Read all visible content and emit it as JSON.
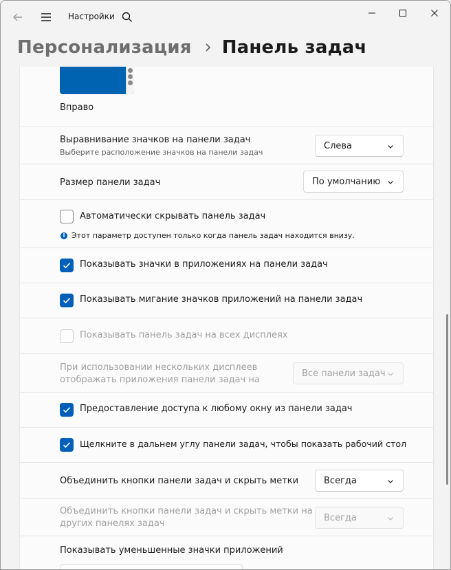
{
  "titlebar": {
    "app_title": "Настройки",
    "back_icon": "back-arrow-icon",
    "menu_icon": "hamburger-icon",
    "search_icon": "search-icon"
  },
  "header": {
    "parent": "Персонализация",
    "current": "Панель задач"
  },
  "accent_color": "#005fb8",
  "preview": {
    "caption": "Вправо"
  },
  "settings": {
    "alignment": {
      "label": "Выравнивание значков на панели задач",
      "sublabel": "Выберите расположение значков на панели задач",
      "value": "Слева"
    },
    "size": {
      "label": "Размер панели задач",
      "value": "По умолчанию"
    },
    "autohide": {
      "label": "Автоматически скрывать панель задач",
      "checked": false,
      "info": "Этот параметр доступен только когда панель задач находится внизу."
    },
    "badges": {
      "label": "Показывать значки в приложениях на панели задач",
      "checked": true
    },
    "flashing": {
      "label": "Показывать мигание значков приложений на панели задач",
      "checked": true
    },
    "all_displays": {
      "label": "Показывать панель задач на всех дисплеях",
      "checked": false,
      "disabled": true
    },
    "multi_display": {
      "label_line1": "При использовании нескольких дисплеев",
      "label_line2": "отображать приложения панели задач на",
      "value": "Все панели задач",
      "disabled": true
    },
    "share_window": {
      "label": "Предоставление доступа к любому окну из панели задач",
      "checked": true
    },
    "show_desktop": {
      "label": "Щелкните в дальнем углу панели задач, чтобы показать рабочий стол",
      "checked": true
    },
    "combine": {
      "label": "Объединить кнопки панели задач и скрыть метки",
      "value": "Всегда"
    },
    "combine_other": {
      "label_line1": "Объединить кнопки панели задач и скрыть метки на",
      "label_line2": "других панелях задач",
      "value": "Всегда",
      "disabled": true
    },
    "small_icons": {
      "label": "Показывать уменьшенные значки приложений"
    }
  }
}
